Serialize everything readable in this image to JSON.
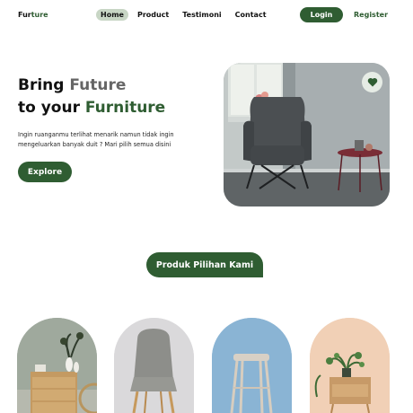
{
  "nav": {
    "logo_prefix": "Fur",
    "logo_accent": "ture",
    "items": [
      {
        "label": "Home",
        "active": true
      },
      {
        "label": "Product",
        "active": false
      },
      {
        "label": "Testimoni",
        "active": false
      },
      {
        "label": "Contact",
        "active": false
      }
    ],
    "login_label": "Login",
    "register_label": "Register"
  },
  "hero": {
    "title_line1_a": "Bring ",
    "title_line1_b": "Future",
    "title_line2_a": "to your ",
    "title_line2_b": "Furniture",
    "description": "Ingin ruanganmu terlihat menarik namun tidak ingin mengeluarkan banyak duit ? Mari pilih semua disini",
    "cta_label": "Explore",
    "image_icon": "heart-icon"
  },
  "section": {
    "title": "Produk Pilihan Kami"
  },
  "products": [
    {
      "image": "dresser-with-vases"
    },
    {
      "image": "grey-upholstered-chair"
    },
    {
      "image": "wooden-stool"
    },
    {
      "image": "nightstand-with-plant"
    }
  ],
  "colors": {
    "brand": "#2f5d32",
    "nav_active": "#c8d6c5"
  }
}
